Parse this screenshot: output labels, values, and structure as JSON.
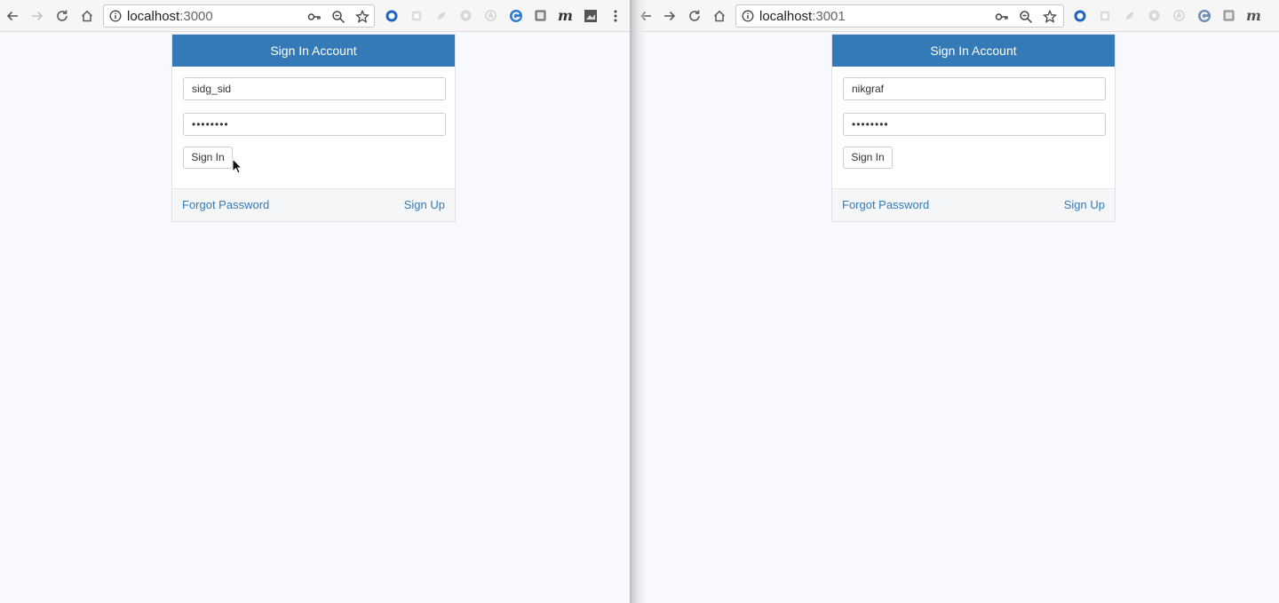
{
  "left_window": {
    "url_host": "localhost",
    "url_port": ":3000",
    "card": {
      "header": "Sign In Account",
      "username_value": "sidg_sid",
      "password_value": "••••••••",
      "signin_label": "Sign In",
      "forgot_label": "Forgot Password",
      "signup_label": "Sign Up"
    }
  },
  "right_window": {
    "url_host": "localhost",
    "url_port": ":3001",
    "card": {
      "header": "Sign In Account",
      "username_value": "nikgraf",
      "password_value": "••••••••",
      "signin_label": "Sign In",
      "forgot_label": "Forgot Password",
      "signup_label": "Sign Up"
    }
  },
  "colors": {
    "accent": "#337ab7",
    "page_bg": "#f7f9fc",
    "toolbar_bg": "#f6f6f6"
  },
  "icons": [
    "back-arrow-icon",
    "forward-arrow-icon",
    "reload-icon",
    "home-icon",
    "info-icon",
    "key-icon",
    "zoom-icon",
    "bookmark-star-icon",
    "extension-icon",
    "more-menu-icon",
    "mouse-cursor-icon"
  ]
}
